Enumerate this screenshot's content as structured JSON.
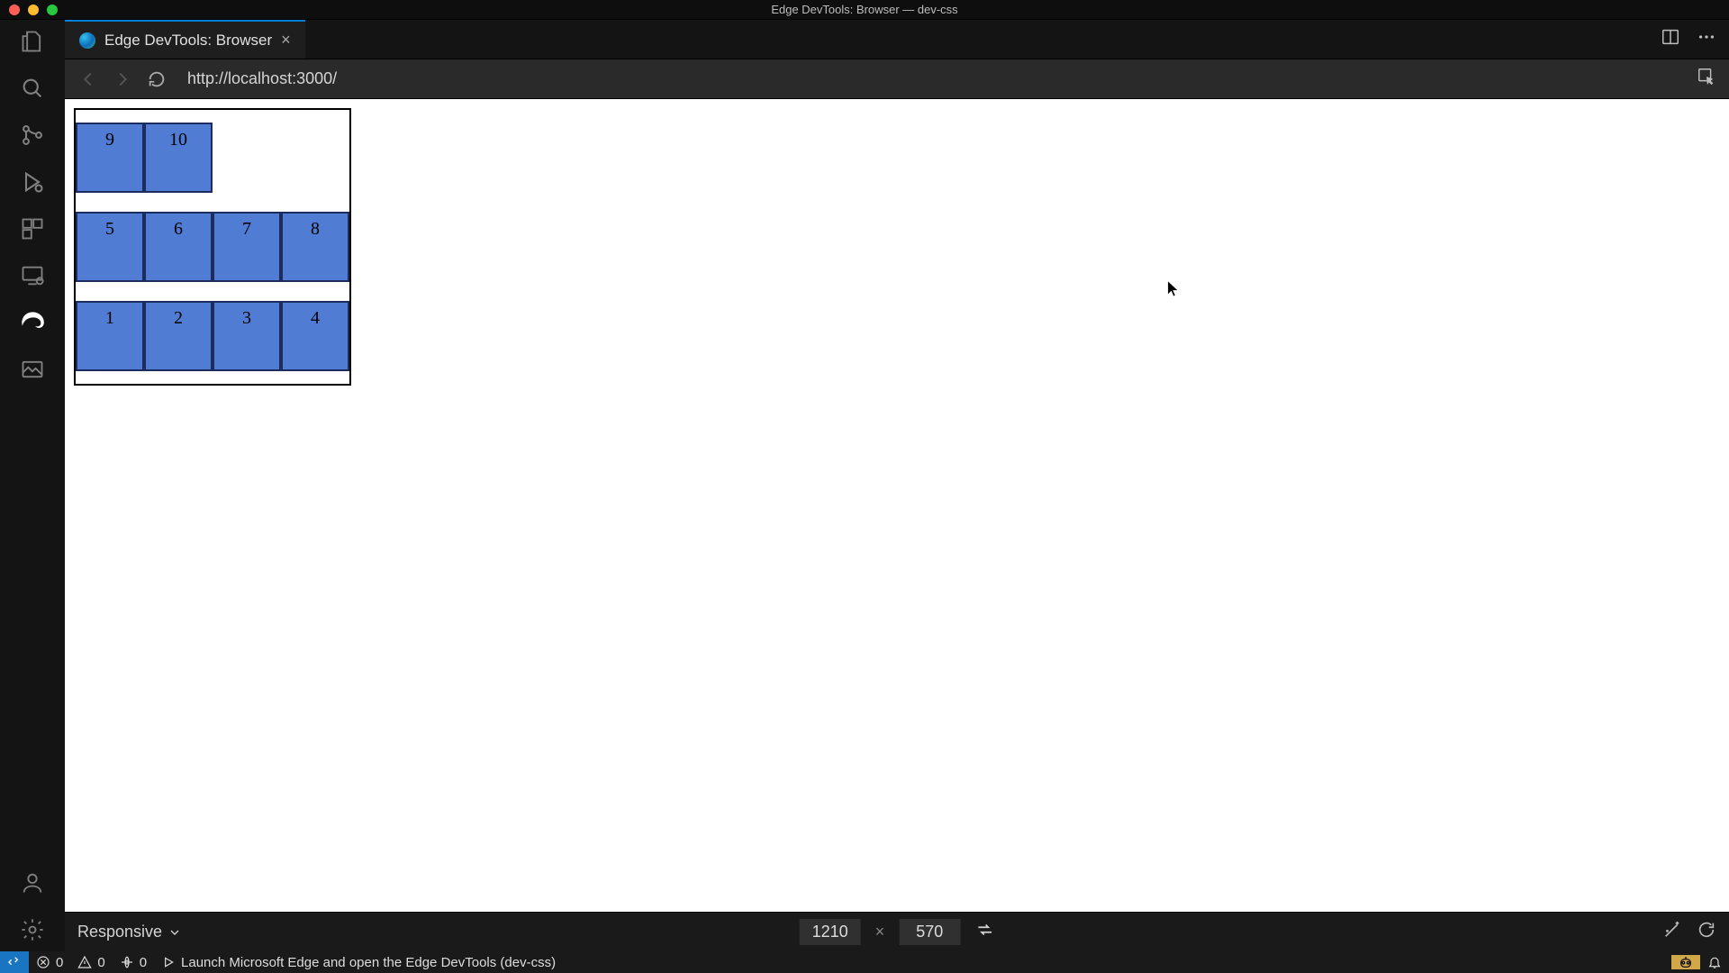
{
  "window": {
    "title": "Edge DevTools: Browser — dev-css"
  },
  "tab": {
    "label": "Edge DevTools: Browser",
    "close_label": "×"
  },
  "nav": {
    "url": "http://localhost:3000/"
  },
  "page": {
    "cells": [
      "1",
      "2",
      "3",
      "4",
      "5",
      "6",
      "7",
      "8",
      "9",
      "10"
    ]
  },
  "device_toolbar": {
    "mode": "Responsive",
    "width": "1210",
    "separator": "×",
    "height": "570"
  },
  "status": {
    "errors": "0",
    "warnings": "0",
    "ports": "0",
    "debug_label": "Launch Microsoft Edge and open the Edge DevTools (dev-css)"
  }
}
